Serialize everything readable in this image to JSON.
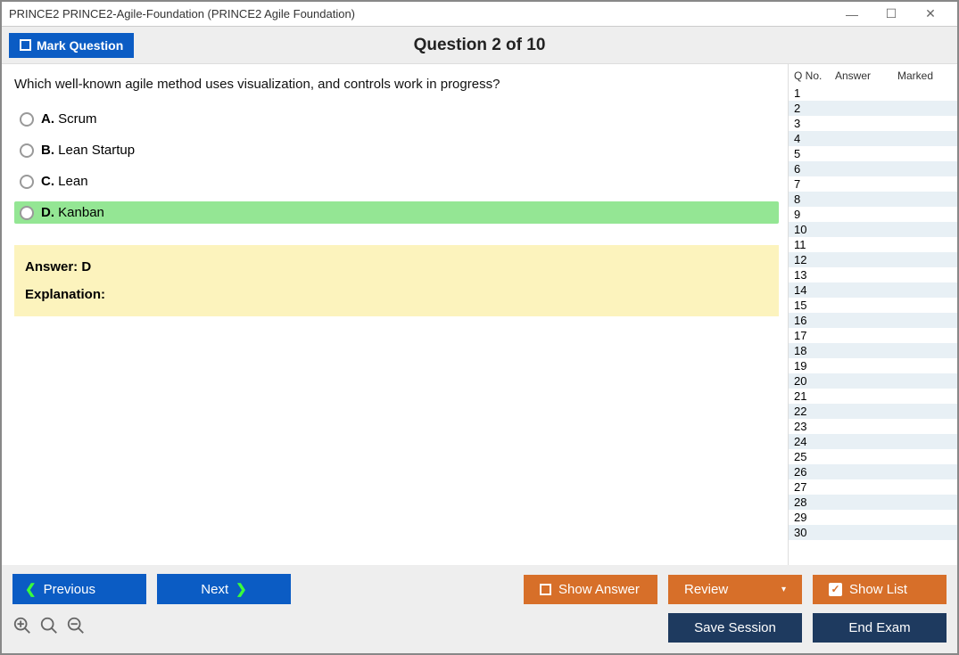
{
  "window": {
    "title": "PRINCE2 PRINCE2-Agile-Foundation (PRINCE2 Agile Foundation)"
  },
  "header": {
    "mark_label": "Mark Question",
    "q_title": "Question 2 of 10"
  },
  "question": {
    "text": "Which well-known agile method uses visualization, and controls work in progress?",
    "options": [
      {
        "letter": "A.",
        "text": "Scrum",
        "correct": false
      },
      {
        "letter": "B.",
        "text": "Lean Startup",
        "correct": false
      },
      {
        "letter": "C.",
        "text": "Lean",
        "correct": false
      },
      {
        "letter": "D.",
        "text": "Kanban",
        "correct": true
      }
    ]
  },
  "answer_panel": {
    "answer": "Answer: D",
    "explanation": "Explanation:"
  },
  "side": {
    "h1": "Q No.",
    "h2": "Answer",
    "h3": "Marked",
    "rows": [
      "1",
      "2",
      "3",
      "4",
      "5",
      "6",
      "7",
      "8",
      "9",
      "10",
      "11",
      "12",
      "13",
      "14",
      "15",
      "16",
      "17",
      "18",
      "19",
      "20",
      "21",
      "22",
      "23",
      "24",
      "25",
      "26",
      "27",
      "28",
      "29",
      "30"
    ]
  },
  "footer": {
    "previous": "Previous",
    "next": "Next",
    "show_answer": "Show Answer",
    "review": "Review",
    "show_list": "Show List",
    "save": "Save Session",
    "end": "End Exam"
  }
}
